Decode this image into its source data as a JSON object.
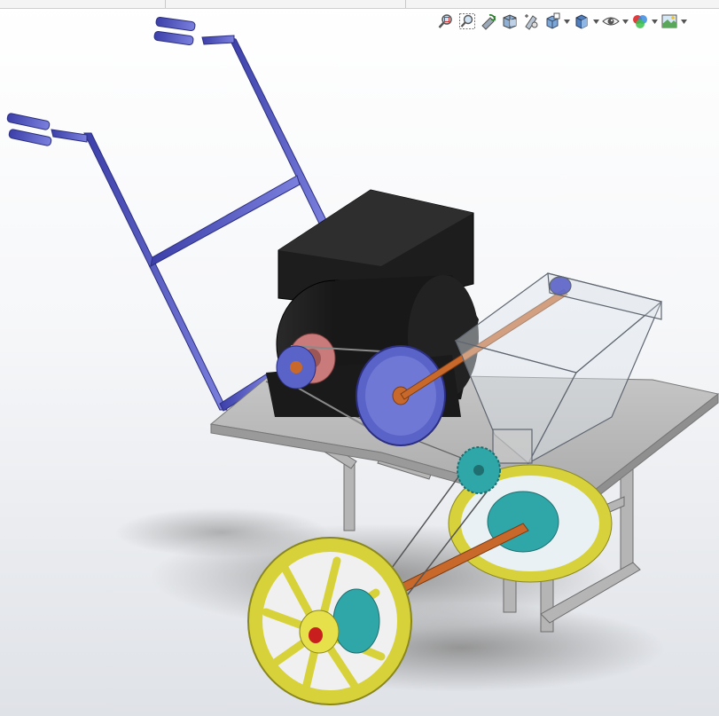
{
  "viewport": {
    "background_top": "#ffffff",
    "background_bottom": "#dfe2e7"
  },
  "heads_up_toolbar": {
    "items": [
      {
        "icon": "zoom-to-fit-icon",
        "dropdown": false
      },
      {
        "icon": "zoom-to-area-icon",
        "dropdown": false
      },
      {
        "icon": "previous-view-icon",
        "dropdown": false
      },
      {
        "icon": "section-view-icon",
        "dropdown": false
      },
      {
        "icon": "dynamic-annotation-views-icon",
        "dropdown": false
      },
      {
        "icon": "view-orientation-icon",
        "dropdown": true
      },
      {
        "icon": "display-style-icon",
        "dropdown": true
      },
      {
        "icon": "hide-show-items-icon",
        "dropdown": true
      },
      {
        "icon": "edit-appearance-icon",
        "dropdown": true
      },
      {
        "icon": "apply-scene-icon",
        "dropdown": true
      }
    ]
  },
  "model": {
    "handle_color": "#5a5fc4",
    "motor_color": "#1e1e1e",
    "pulley_color": "#5a63c8",
    "motor_pulley_color": "#c97a7a",
    "frame_color": "#b8b8b8",
    "wheel_color": "#e6e04a",
    "hub_color": "#2fa6a8",
    "axle_color": "#c8682a",
    "hopper_color": "#cfd6df"
  }
}
